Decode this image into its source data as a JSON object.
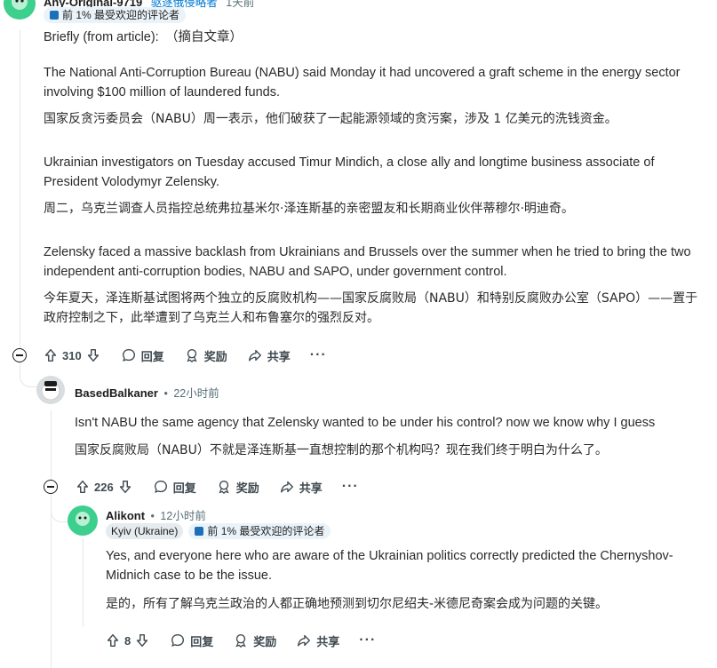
{
  "top_comment": {
    "author": "Any-Original-9719",
    "author_flair": "驱逐俄侵略者",
    "time": "1天前",
    "badge": "前 1% 最受欢迎的评论者",
    "para0": "Briefly (from article):　（摘自文章）",
    "para1_en": "The National Anti-Corruption Bureau (NABU) said Monday it had uncovered a graft scheme in the energy sector involving $100 million of laundered funds.",
    "para1_zh": "国家反贪污委员会（NABU）周一表示，他们破获了一起能源领域的贪污案，涉及 1 亿美元的洗钱资金。",
    "para2_en": "Ukrainian investigators on Tuesday accused Timur Mindich, a close ally and longtime business associate of President Volodymyr Zelensky.",
    "para2_zh": "周二，乌克兰调查人员指控总统弗拉基米尔·泽连斯基的亲密盟友和长期商业伙伴蒂穆尔·明迪奇。",
    "para3_en": "Zelensky faced a massive backlash from Ukrainians and Brussels over the summer when he tried to bring the two independent anti-corruption bodies, NABU and SAPO, under government control.",
    "para3_zh": "今年夏天，泽连斯基试图将两个独立的反腐败机构——国家反腐败局（NABU）和特别反腐败办公室（SAPO）——置于政府控制之下，此举遭到了乌克兰人和布鲁塞尔的强烈反对。",
    "votes": "310",
    "reply": "回复",
    "award": "奖励",
    "share": "共享",
    "more": "···"
  },
  "reply1": {
    "author": "BasedBalkaner",
    "sep": "•",
    "time": "22小时前",
    "text_en": "Isn't NABU the same agency that Zelensky wanted to be under his control? now we know why I guess",
    "text_zh": "国家反腐败局（NABU）不就是泽连斯基一直想控制的那个机构吗？现在我们终于明白为什么了。",
    "votes": "226",
    "reply": "回复",
    "award": "奖励",
    "share": "共享",
    "more": "···"
  },
  "reply2": {
    "author": "Alikont",
    "sep": "•",
    "time": "12小时前",
    "flair": "Kyiv (Ukraine)",
    "badge": "前 1% 最受欢迎的评论者",
    "text_en": "Yes, and everyone here who are aware of the Ukrainian politics correctly predicted the Chernyshov-Midnich case to be the issue.",
    "text_zh": "是的，所有了解乌克兰政治的人都正确地预测到切尔尼绍夫-米德尼奇案会成为问题的关键。",
    "votes": "8",
    "reply": "回复",
    "award": "奖励",
    "share": "共享",
    "more": "···"
  },
  "colors": {
    "avatar_green": "#3ccf8e",
    "badge_bg": "#eaf3fa",
    "thread_line": "#e3e6e8"
  }
}
